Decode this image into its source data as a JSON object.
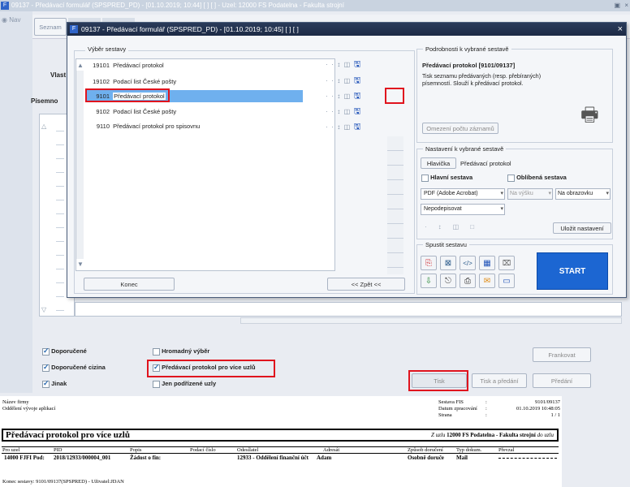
{
  "outer_title": "09137 - Předávací formulář (SPSPRED_PD) - [01.10.2019; 10:44]  [ ] [ ] - Uzel: 12000 FS Podatelna - Fakulta strojní",
  "outer_left": {
    "nav": "Nav",
    "seznam": "Seznam",
    "vlast": "Vlast",
    "pisemn": "Písemno"
  },
  "dialog": {
    "title": "09137 - Předávací formulář (SPSPRED_PD) - [01.10.2019; 10:45]  [ ] [ ]",
    "close": "×",
    "vyber_label": "Výběr sestavy",
    "rows": [
      {
        "code": "19101",
        "name": "Předávací protokol"
      },
      {
        "code": "19102",
        "name": "Podací list České pošty"
      },
      {
        "code": "9101",
        "name": "Předávací protokol"
      },
      {
        "code": "9102",
        "name": "Podací list České pošty"
      },
      {
        "code": "9110",
        "name": "Předávací protokol pro spisovnu"
      }
    ],
    "konec": "Konec",
    "zpet": "<< Zpět <<",
    "podrobnosti_label": "Podrobnosti k vybrané sestavě",
    "detail_title": "Předávací protokol [9101/09137]",
    "detail_desc": "Tisk seznamu předávaných (resp. přebíraných) písemností. Slouží k předávací protokol.",
    "omezeni": "Omezení počtu záznamů",
    "nastaveni_label": "Nastavení k vybrané sestavě",
    "hlavicka": "Hlavička",
    "hlavicka_value": "Předávací protokol",
    "hlavni": "Hlavní sestava",
    "oblibena": "Oblíbená sestava",
    "format": "PDF (Adobe Acrobat)",
    "vyska": "Na výšku",
    "obrazovka": "Na obrazovku",
    "podpis": "Nepodepisovat",
    "ulozit": "Uložit nastavení",
    "spustit_label": "Spustit sestavu",
    "start": "START"
  },
  "bottom": {
    "doporucene": "Doporučené",
    "doporucene_cizina": "Doporučené cizina",
    "jinak": "Jinak",
    "hromadny": "Hromadný výběr",
    "pro_vice": "Předávací protokol pro více uzlů",
    "jen_podrizene": "Jen podřízené uzly",
    "frankovat": "Frankovat",
    "tisk": "Tisk",
    "tisk_predani": "Tisk a předání",
    "predani": "Předání"
  },
  "report": {
    "firm": "Název firmy",
    "dept": "Oddělení vývoje aplikací",
    "meta": [
      {
        "k": "Sestava FIS",
        "v": "9101/09137"
      },
      {
        "k": "Datum zpracování",
        "v": "01.10.2019 10:48:05"
      },
      {
        "k": "Strana",
        "v": "1 / 1"
      }
    ],
    "title": "Předávací protokol pro více uzlů",
    "uzel_prefix": "Z uzlu",
    "uzel": "12000 FS Podatelna - Fakulta strojní",
    "uzel_suffix": "do uzlu",
    "cols": [
      "Pro uzel",
      "PID",
      "Popis",
      "Podací číslo",
      "Odesílatel",
      "Adresát",
      "Způsob doručení",
      "Typ dokum.",
      "Převzal"
    ],
    "row": {
      "uzel": "14000 FJFI Pod:",
      "pid": "2018/12933/000004_001",
      "popis": "Žádost o fin:",
      "odesilatel": "12933 - Oddělení finanční účt",
      "adresat": "Adam",
      "zpusob": "Osobně doruče",
      "typ": "Mail"
    },
    "footer": "Konec sestavy: 9101/09137(SPSPRED) - Uživatel:JDAN"
  }
}
